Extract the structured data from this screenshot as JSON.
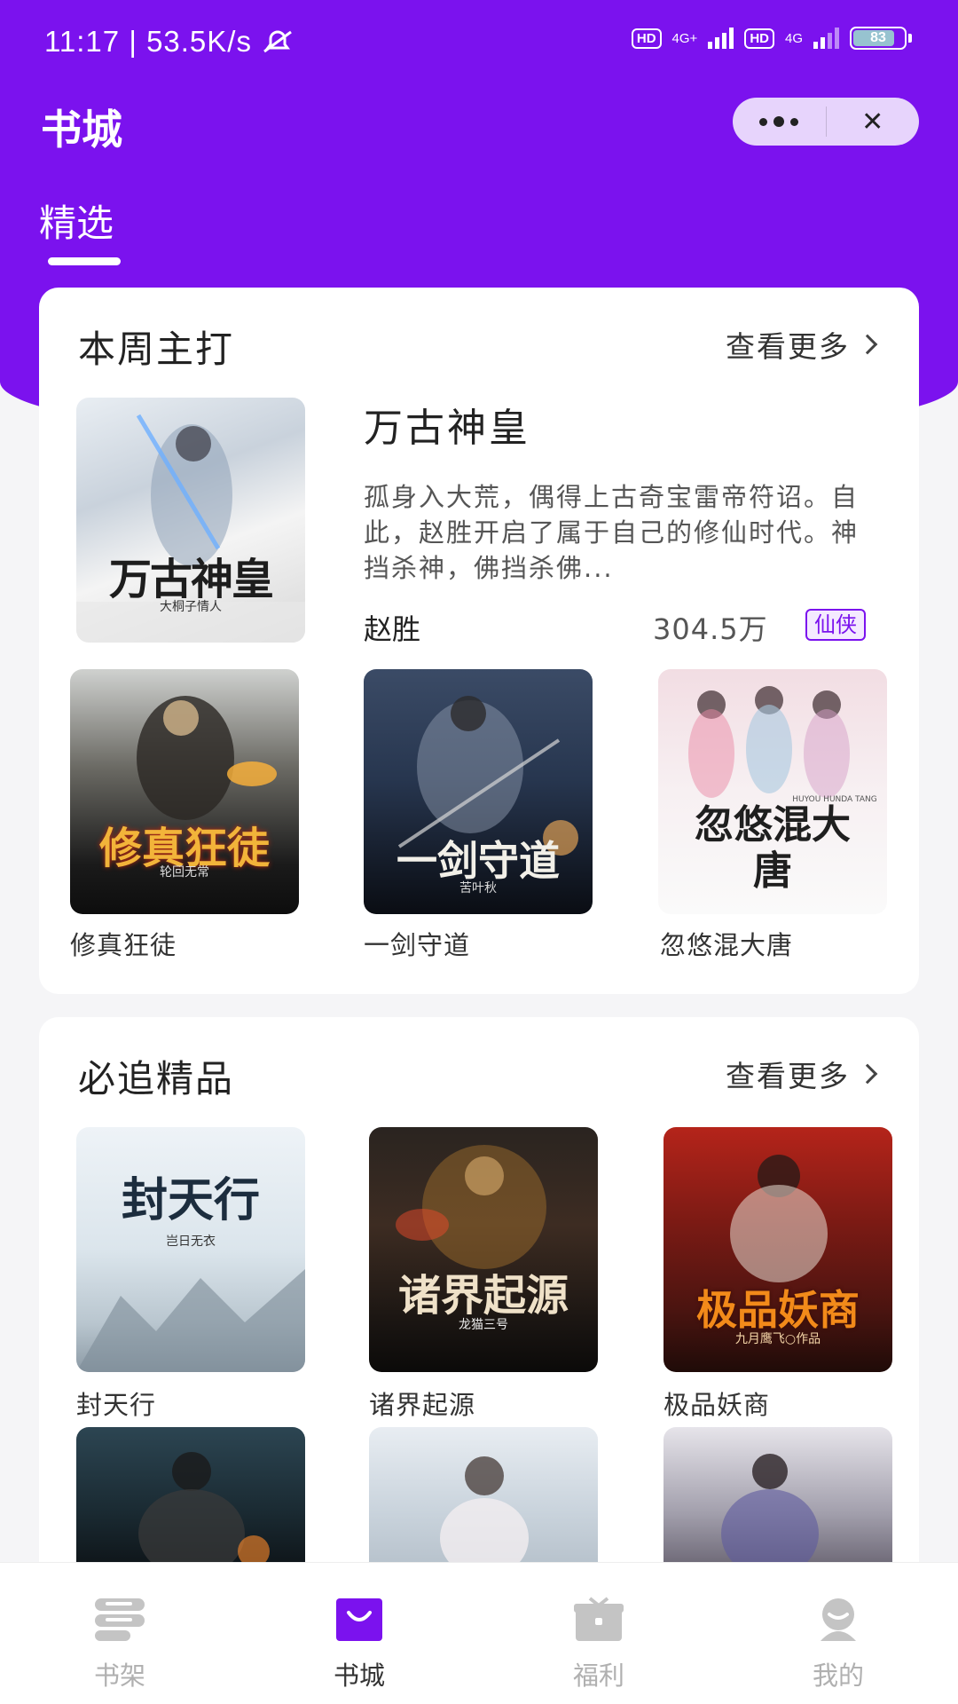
{
  "status_bar": {
    "time": "11:17",
    "separator": "|",
    "speed": "53.5K/s",
    "hd1": "HD",
    "net1": "4G+",
    "hd2": "HD",
    "net2": "4G",
    "battery": "83",
    "battery_level": 0.83
  },
  "header": {
    "title": "书城",
    "tab_active": "精选",
    "capsule_more_icon": "more-dots-icon",
    "capsule_close": "✕"
  },
  "colors": {
    "brand": "#7b12ee",
    "background": "#f5f5f7"
  },
  "section_featured": {
    "title": "本周主打",
    "more_label": "查看更多",
    "featured_book": {
      "title": "万古神皇",
      "description": "孤身入大荒，偶得上古奇宝雷帝符诏。自此，赵胜开启了属于自己的修仙时代。神挡杀神，佛挡杀佛...",
      "author": "赵胜",
      "count": "304.5万",
      "tag": "仙侠",
      "cover_title": "万古神皇",
      "cover_author": "大桐子情人"
    },
    "books": [
      {
        "name": "修真狂徒",
        "cover_title": "修真狂徒",
        "cover_author": "轮回无常"
      },
      {
        "name": "一剑守道",
        "cover_title": "一剑守道",
        "cover_author": "苦叶秋"
      },
      {
        "name": "忽悠混大唐",
        "cover_title": "忽悠混大唐",
        "cover_author": "HUYOU HUNDA TANG"
      }
    ]
  },
  "section_must": {
    "title": "必追精品",
    "more_label": "查看更多",
    "books": [
      {
        "name": "封天行",
        "cover_title": "封天行",
        "cover_author": "岂日无衣"
      },
      {
        "name": "诸界起源",
        "cover_title": "诸界起源",
        "cover_author": "龙猫三号"
      },
      {
        "name": "极品妖商",
        "cover_title": "极品妖商",
        "cover_author": "九月鹰飞○作品"
      }
    ]
  },
  "bottom_nav": [
    {
      "label": "书架",
      "icon": "bookshelf-icon",
      "active": false
    },
    {
      "label": "书城",
      "icon": "bookstore-bag-icon",
      "active": true
    },
    {
      "label": "福利",
      "icon": "gift-icon",
      "active": false
    },
    {
      "label": "我的",
      "icon": "profile-icon",
      "active": false
    }
  ]
}
